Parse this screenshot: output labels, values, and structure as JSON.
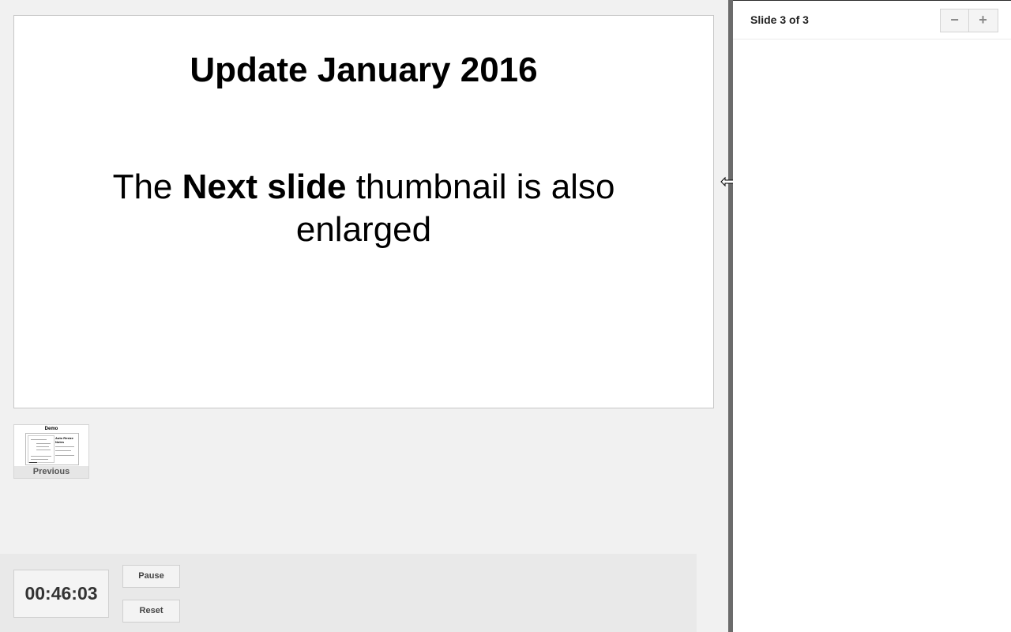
{
  "slide": {
    "title": "Update January 2016",
    "body_before": "The ",
    "body_bold": "Next slide",
    "body_after": " thumbnail is also enlarged"
  },
  "previous_thumbnail": {
    "label": "Previous",
    "preview_title": "Demo",
    "preview_heading": "Auto Resize Notes"
  },
  "timer": {
    "value": "00:46:03",
    "pause_label": "Pause",
    "reset_label": "Reset"
  },
  "notes_panel": {
    "slide_counter": "Slide 3 of 3",
    "zoom_out_label": "−",
    "zoom_in_label": "+"
  }
}
